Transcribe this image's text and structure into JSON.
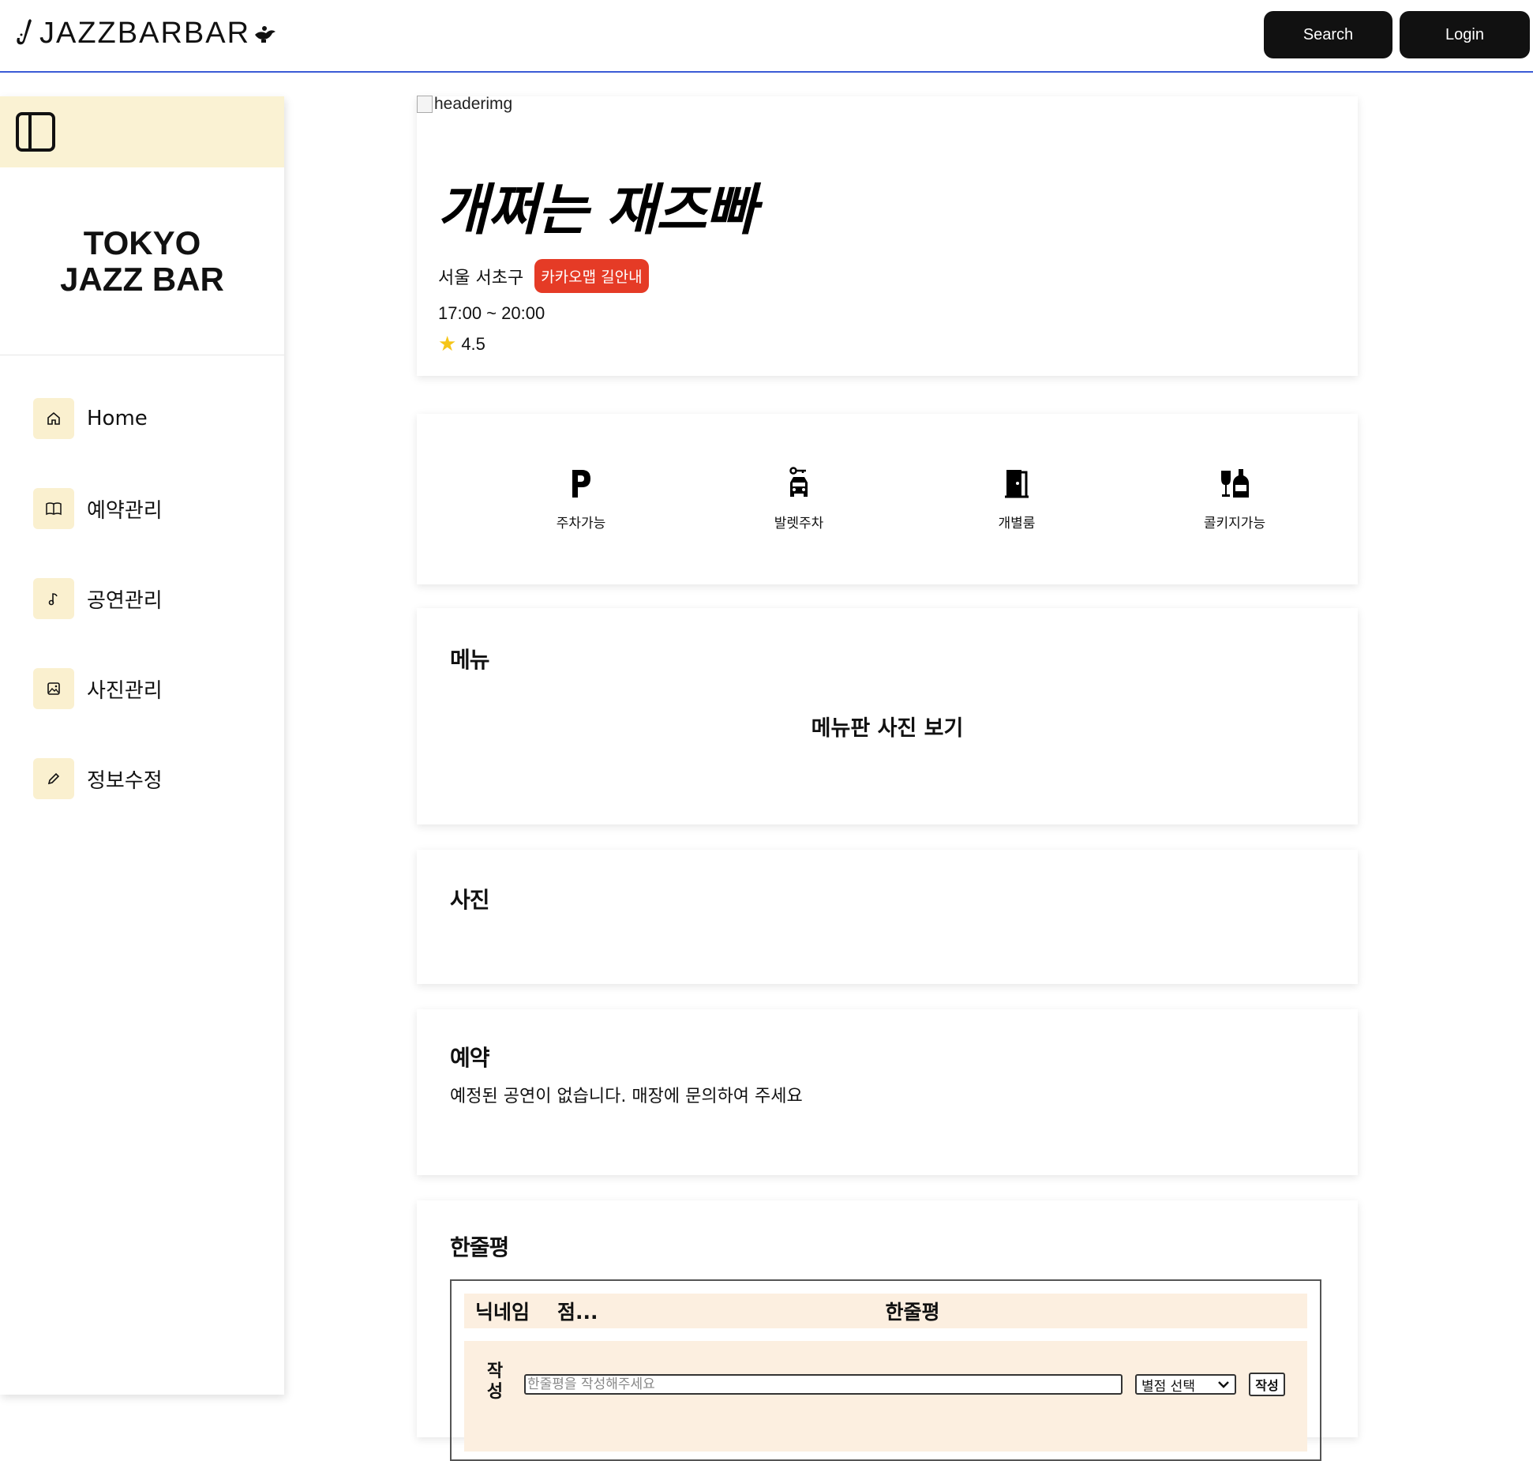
{
  "header": {
    "logo_text": "JAZZBARBAR",
    "search_label": "Search",
    "login_label": "Login"
  },
  "sidebar": {
    "title_line1": "TOKYO",
    "title_line2": "JAZZ BAR",
    "items": [
      {
        "label": "Home",
        "icon": "home-icon"
      },
      {
        "label": "예약관리",
        "icon": "book-icon"
      },
      {
        "label": "공연관리",
        "icon": "music-note-icon"
      },
      {
        "label": "사진관리",
        "icon": "image-icon"
      },
      {
        "label": "정보수정",
        "icon": "pencil-icon"
      }
    ]
  },
  "bar": {
    "header_img_alt": "headerimg",
    "name": "개쩌는 재즈빠",
    "address": "서울 서초구",
    "map_button": "카카오맵 길안내",
    "hours": "17:00 ~ 20:00",
    "rating": "4.5"
  },
  "amenities": [
    {
      "label": "주차가능",
      "icon": "parking-icon"
    },
    {
      "label": "발렛주차",
      "icon": "valet-icon"
    },
    {
      "label": "개별룸",
      "icon": "door-icon"
    },
    {
      "label": "콜키지가능",
      "icon": "bottle-glass-icon"
    }
  ],
  "menu": {
    "title": "메뉴",
    "link": "메뉴판 사진 보기"
  },
  "photos": {
    "title": "사진"
  },
  "reservation": {
    "title": "예약",
    "empty_text": "예정된 공연이 없습니다. 매장에 문의하여 주세요"
  },
  "reviews": {
    "title": "한줄평",
    "col_nickname": "닉네임",
    "col_score": "점...",
    "col_review": "한줄평",
    "form_label": "작성",
    "input_placeholder": "한줄평을 작성해주세요",
    "select_label": "별점 선택",
    "submit_label": "작성"
  },
  "colors": {
    "accent_line": "#3b5bd6",
    "sidebar_highlight": "#faf2d3",
    "kakao_button": "#e53b26",
    "review_bg": "#fcefe0"
  }
}
